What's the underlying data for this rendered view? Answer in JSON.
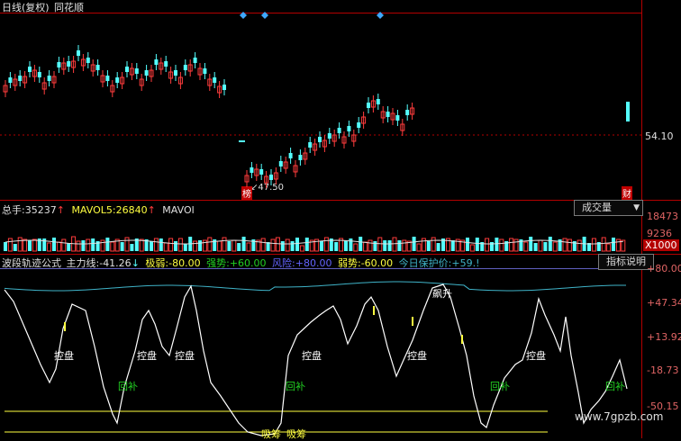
{
  "header": {
    "period_label": "日线(复权)",
    "app_name": "同花顺"
  },
  "price_panel": {
    "right_price": "54.10",
    "low_marker": "↙",
    "low_value": "47.50",
    "left_marker": "榜",
    "right_marker": "财"
  },
  "volume_panel": {
    "total_label": "总手:",
    "total_value": "35237",
    "mavol5_label": "MAVOL5:",
    "mavol5_value": "26840",
    "mavol10_label": "MAVOl",
    "dropdown_label": "成交量",
    "axis_labels": [
      "18473",
      "9236",
      "X1000"
    ]
  },
  "indicator_panel": {
    "name": "波段轨迹公式",
    "main_label": "主力线:",
    "main_value": "-41.26",
    "extreme_weak_label": "极弱:",
    "extreme_weak_value": "-80.00",
    "strong_label": "强势:",
    "strong_value": "+60.00",
    "risk_label": "风险:",
    "risk_value": "+80.00",
    "weak_label": "弱势:",
    "weak_value": "-60.00",
    "protect_label": "今日保护价:",
    "protect_value": "+59.!",
    "help_button": "指标说明",
    "axis_labels": [
      "+80.00",
      "+47.34",
      "+13.92",
      "-18.73",
      "-50.15"
    ],
    "annotations": {
      "control1": "控盘",
      "control2": "控盘",
      "control3": "控盘",
      "control4": "控盘",
      "control5": "控盘",
      "pullback1": "回补",
      "pullback2": "回补",
      "pullback3": "回补",
      "pullback4": "回补",
      "rise": "飙升",
      "absorb1": "吸筹",
      "absorb2": "吸筹"
    }
  },
  "watermark": "www.7gpzb.com",
  "colors": {
    "up": "#ff3c3c",
    "down": "#54ffff",
    "grid": "#b40000",
    "main_line": "#ffffff",
    "cyan_line": "#3fb3c8",
    "strong": "#22d022",
    "risk": "#6464ff",
    "weak": "#ffff40"
  }
}
